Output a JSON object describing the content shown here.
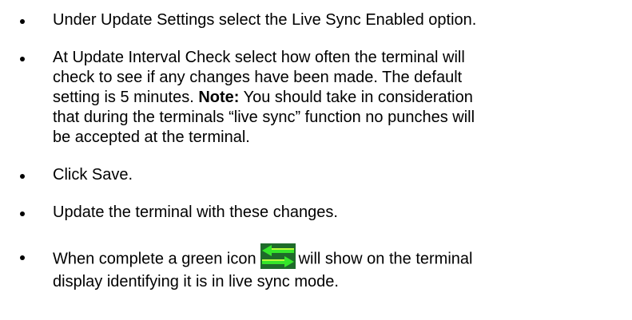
{
  "items": [
    {
      "lines": [
        "Under Update Settings select the Live Sync Enabled option."
      ]
    },
    {
      "lines": [
        "At Update Interval Check select how often the terminal will",
        "check to see if any changes have been made. The default",
        "setting is 5 minutes. ",
        "that during the terminals “live sync” function no punches will",
        "be accepted at the terminal."
      ],
      "note_label": "Note:",
      "note_rest": " You should take in consideration"
    },
    {
      "lines": [
        "Click Save."
      ]
    },
    {
      "lines": [
        "Update the terminal with these changes."
      ]
    },
    {
      "before_icon": "When complete a green icon",
      "after_icon": "will show on the terminal",
      "line2": "display identifying it is in live sync mode.",
      "icon": "live-sync-arrows-icon",
      "icon_colors": {
        "background": "#1e6b2a",
        "arrow": "#35e62a",
        "arrow_shade": "#b9ff3a"
      }
    }
  ]
}
